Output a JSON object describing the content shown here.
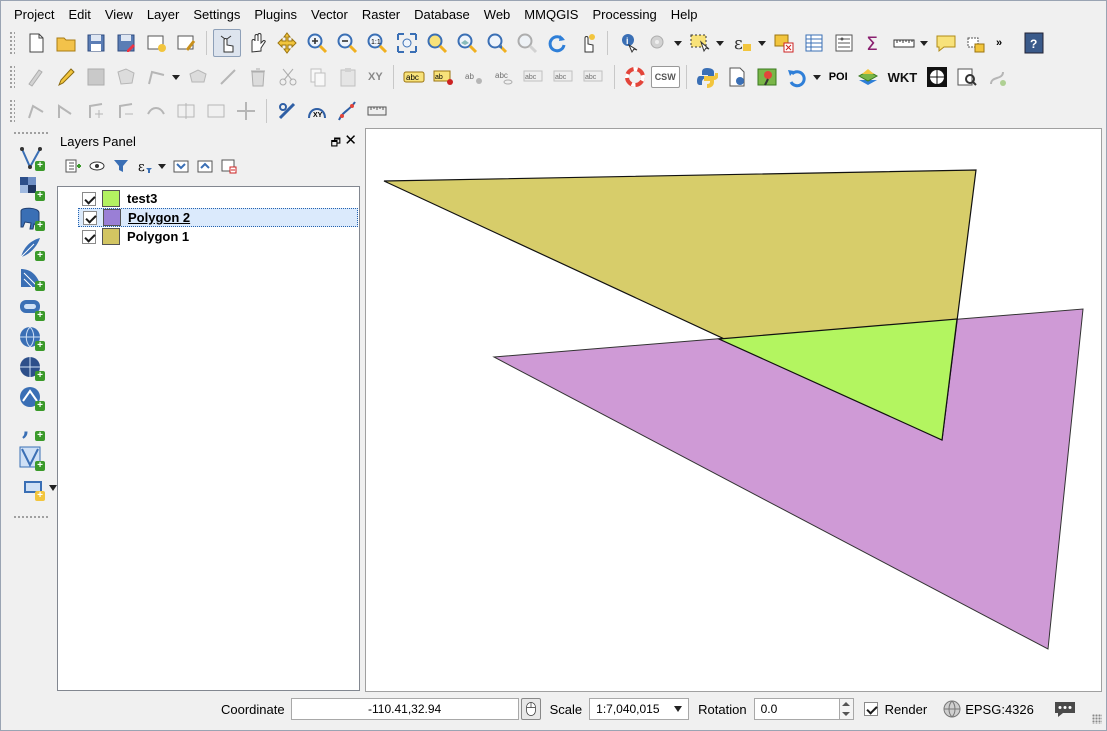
{
  "menu": [
    "Project",
    "Edit",
    "View",
    "Layer",
    "Settings",
    "Plugins",
    "Vector",
    "Raster",
    "Database",
    "Web",
    "MMQGIS",
    "Processing",
    "Help"
  ],
  "toolbar_labels": {
    "csw": "CSW",
    "poi": "POI",
    "wkt": "WKT",
    "xy": "XY",
    "label_abc": "abc",
    "overflow": "»",
    "help": "?"
  },
  "layers_panel": {
    "title": "Layers Panel",
    "layers": [
      {
        "name": "test3",
        "color": "#b3f261",
        "checked": true,
        "selected": false
      },
      {
        "name": "Polygon 2",
        "color": "#9a7fd6",
        "checked": true,
        "selected": true
      },
      {
        "name": "Polygon 1",
        "color": "#d2c562",
        "checked": true,
        "selected": false
      }
    ]
  },
  "map": {
    "polygon1_fill": "#d7cd6a",
    "polygon2_fill": "#cf9ad6",
    "test3_fill": "#b3f560",
    "stroke": "#000000"
  },
  "status": {
    "coordinate_label": "Coordinate",
    "coordinate_value": "-110.41,32.94",
    "scale_label": "Scale",
    "scale_value": "1:7,040,015",
    "rotation_label": "Rotation",
    "rotation_value": "0.0",
    "render_label": "Render",
    "render_checked": true,
    "crs": "EPSG:4326"
  }
}
